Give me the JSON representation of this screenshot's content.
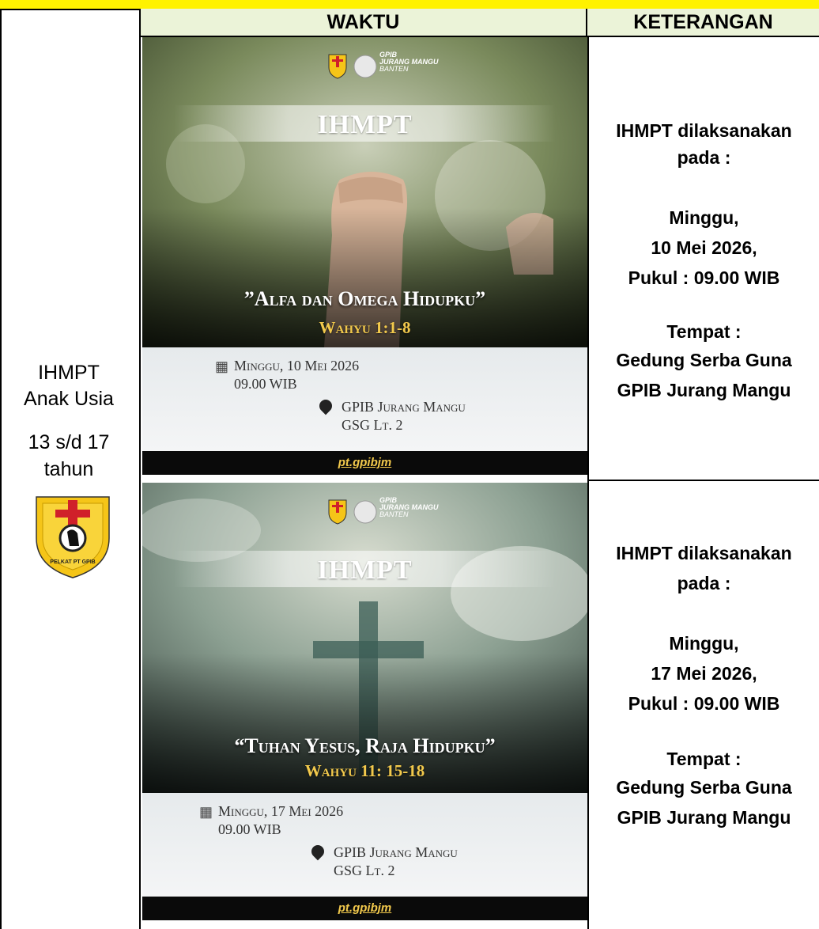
{
  "table": {
    "header_waktu": "WAKTU",
    "header_keterangan": "KETERANGAN"
  },
  "left_cell": {
    "line1": "IHMPT",
    "line2": "Anak Usia",
    "line3": "13 s/d 17",
    "line4": "tahun",
    "logo_text": "PELKAT PT GPIB"
  },
  "rows": [
    {
      "poster": {
        "brand_line1": "GPIB",
        "brand_line2": "JURANG MANGU",
        "brand_line3": "BANTEN",
        "title": "IHMPT",
        "theme": "”Alfa dan Omega Hidupku”",
        "verse": "Wahyu 1:1-8",
        "date": "Minggu, 10 Mei 2026",
        "time": "09.00 WIB",
        "venue": "GPIB Jurang Mangu",
        "venue_detail": "GSG Lt. 2",
        "footer": "pt.gpibjm"
      },
      "keterangan": {
        "l1": "IHMPT dilaksanakan",
        "l2": "pada :",
        "l3": "Minggu,",
        "l4": "10 Mei 2026,",
        "l5": "Pukul : 09.00 WIB",
        "l6": "Tempat :",
        "l7": "Gedung Serba Guna",
        "l8": "GPIB Jurang Mangu"
      }
    },
    {
      "poster": {
        "brand_line1": "GPIB",
        "brand_line2": "JURANG MANGU",
        "brand_line3": "BANTEN",
        "title": "IHMPT",
        "theme": "“Tuhan Yesus, Raja Hidupku”",
        "verse": "Wahyu 11: 15-18",
        "date": "Minggu, 17 Mei 2026",
        "time": "09.00 WIB",
        "venue": "GPIB Jurang Mangu",
        "venue_detail": "GSG Lt. 2",
        "footer": "pt.gpibjm"
      },
      "keterangan": {
        "l1": "IHMPT dilaksanakan",
        "l2": "pada :",
        "l3": "Minggu,",
        "l4": "17 Mei 2026,",
        "l5": "Pukul : 09.00 WIB",
        "l6": "Tempat :",
        "l7": "Gedung Serba Guna",
        "l8": "GPIB Jurang Mangu"
      }
    }
  ],
  "colors": {
    "top_bar": "#fff200",
    "header_bg": "#ebf3d8",
    "verse_gold": "#f2c94c",
    "logo_yellow": "#f5c518",
    "logo_red": "#d0202a"
  }
}
